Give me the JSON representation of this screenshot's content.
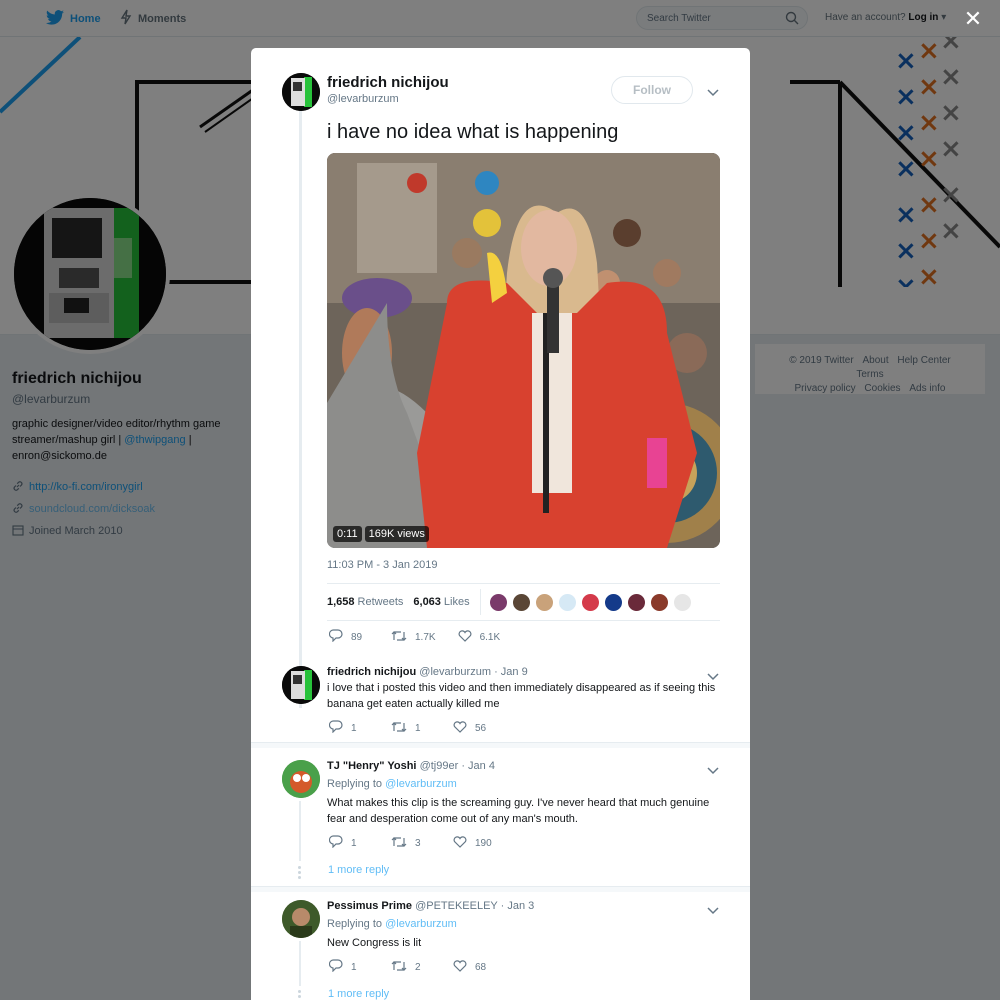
{
  "nav": {
    "home_label": "Home",
    "moments_label": "Moments",
    "search_placeholder": "Search Twitter",
    "account_prompt": "Have an account?",
    "login_label": "Log in"
  },
  "profile": {
    "name": "friedrich nichijou",
    "handle": "@levarburzum",
    "bio_text": "graphic designer/video editor/rhythm game streamer/mashup girl |",
    "bio_mention": "@thwipgang",
    "bio_sep": "|",
    "bio_email": "enron@sickomo.de",
    "website": "http://ko-fi.com/ironygirl",
    "website2": "soundcloud.com/dicksoak",
    "joined": "Joined March 2010"
  },
  "footer": {
    "items": [
      "© 2019 Twitter",
      "About",
      "Help Center",
      "Terms",
      "Privacy policy",
      "Cookies",
      "Ads info"
    ]
  },
  "main_tweet": {
    "name": "friedrich nichijou",
    "handle": "@levarburzum",
    "follow_label": "Follow",
    "text": "i have no idea what is happening",
    "video_duration": "0:11",
    "video_views": "169K views",
    "timestamp": "11:03 PM - 3 Jan 2019",
    "retweets_count": "1,658",
    "retweets_label": "Retweets",
    "likes_count": "6,063",
    "likes_label": "Likes",
    "reply_count": "89",
    "retweet_count": "1.7K",
    "like_count": "6.1K"
  },
  "replies": [
    {
      "name": "friedrich nichijou",
      "handle": "@levarburzum",
      "date": "· Jan 9",
      "replying_label": "",
      "replying_to": "",
      "text": "i love that i posted this video and then immediately disappeared as if seeing this banana get eaten actually killed me",
      "reply_count": "1",
      "retweet_count": "1",
      "like_count": "56",
      "more": ""
    },
    {
      "name": "TJ \"Henry\" Yoshi",
      "handle": "@tj99er",
      "date": "· Jan 4",
      "replying_label": "Replying to",
      "replying_to": "@levarburzum",
      "text": "What makes this clip is the screaming guy. I've never heard that much genuine fear and desperation come out of any man's mouth.",
      "reply_count": "1",
      "retweet_count": "3",
      "like_count": "190",
      "more": "1 more reply"
    },
    {
      "name": "Pessimus Prime",
      "handle": "@PETEKEELEY",
      "date": "· Jan 3",
      "replying_label": "Replying to",
      "replying_to": "@levarburzum",
      "text": "New Congress is lit",
      "reply_count": "1",
      "retweet_count": "2",
      "like_count": "68",
      "more": "1 more reply"
    }
  ],
  "colors": {
    "brand": "#1da1f2",
    "text": "#14171a",
    "muted": "#657786"
  }
}
